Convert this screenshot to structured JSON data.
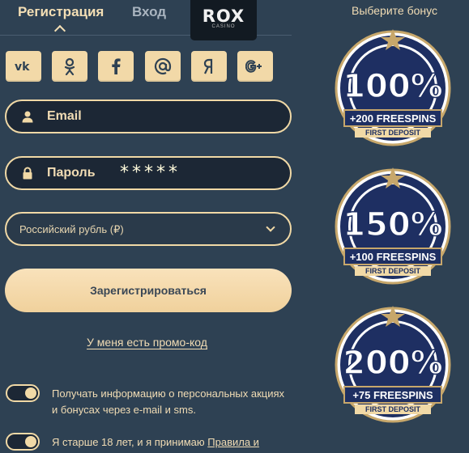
{
  "tabs": {
    "register": "Регистрация",
    "login": "Вход"
  },
  "logo": {
    "text": "ROX",
    "sub": "CASINO"
  },
  "social": [
    "vk-icon",
    "odnoklassniki-icon",
    "facebook-icon",
    "mail-icon",
    "yandex-icon",
    "google-plus-icon"
  ],
  "form": {
    "email_label": "Email",
    "password_label": "Пароль",
    "password_value": "*****",
    "currency": "Российский рубль (₽)",
    "submit": "Зарегистрироваться",
    "promo": "У меня есть промо-код"
  },
  "consents": {
    "info": "Получать информацию о персональных акциях и бонусах через e-mail и sms.",
    "age_prefix": "Я старше 18 лет, и я принимаю",
    "age_link": "Правила и"
  },
  "bonus": {
    "title": "Выберите бонус",
    "items": [
      {
        "percent": "100%",
        "freespins": "+200 FREESPINS",
        "note": "FIRST DEPOSIT"
      },
      {
        "percent": "150%",
        "freespins": "+100 FREESPINS",
        "note": "FIRST DEPOSIT"
      },
      {
        "percent": "200%",
        "freespins": "+75 FREESPINS",
        "note": "FIRST DEPOSIT"
      }
    ]
  },
  "colors": {
    "background": "#2e4153",
    "accent": "#f1d9a6",
    "field": "#1c2735",
    "badge_navy": "#1e2f62"
  }
}
